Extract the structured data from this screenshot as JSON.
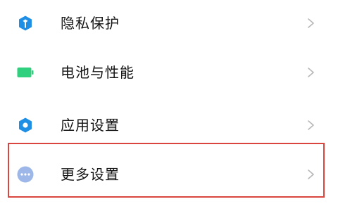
{
  "settings": {
    "items": [
      {
        "label": "隐私保护",
        "icon": "privacy-shield-icon",
        "icon_color": "#1f8fe6"
      },
      {
        "label": "电池与性能",
        "icon": "battery-icon",
        "icon_color": "#2fd07e"
      },
      {
        "label": "应用设置",
        "icon": "gear-icon",
        "icon_color": "#1f8fe6"
      },
      {
        "label": "更多设置",
        "icon": "more-dots-icon",
        "icon_color": "#9db7e8"
      }
    ],
    "highlighted_item": "更多设置",
    "highlight_color": "#d9463f"
  }
}
